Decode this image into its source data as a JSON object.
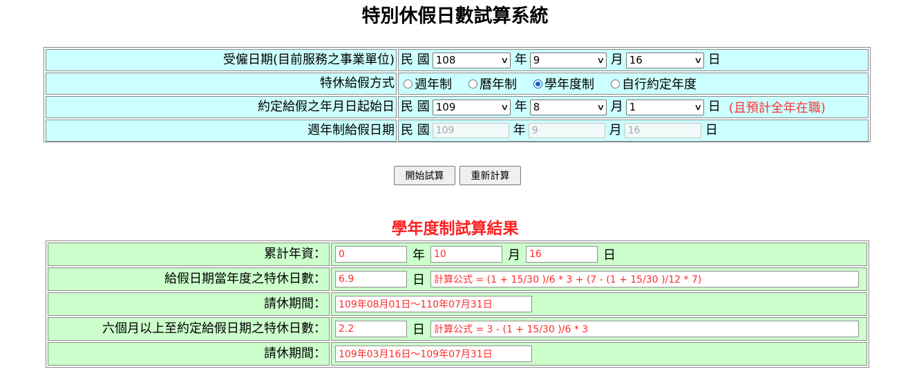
{
  "title": "特別休假日數試算系統",
  "form": {
    "hire_date": {
      "label": "受僱日期(目前服務之事業單位)",
      "prefix": "民 國",
      "year": "108",
      "year_unit": "年",
      "month": "9",
      "month_unit": "月",
      "day": "16",
      "day_unit": "日"
    },
    "leave_method": {
      "label": "特休給假方式",
      "options": [
        {
          "label": "週年制",
          "checked": false
        },
        {
          "label": "曆年制",
          "checked": false
        },
        {
          "label": "學年度制",
          "checked": true
        },
        {
          "label": "自行約定年度",
          "checked": false
        }
      ]
    },
    "agreed_start": {
      "label": "約定給假之年月日起始日",
      "prefix": "民 國",
      "year": "109",
      "year_unit": "年",
      "month": "8",
      "month_unit": "月",
      "day": "1",
      "day_unit": "日",
      "note": "(且預計全年在職)"
    },
    "anniversary_date": {
      "label": "週年制給假日期",
      "prefix": "民 國",
      "year": "109",
      "year_unit": "年",
      "month": "9",
      "month_unit": "月",
      "day": "16",
      "day_unit": "日"
    }
  },
  "buttons": {
    "calculate": "開始試算",
    "recalculate": "重新計算"
  },
  "result": {
    "title": "學年度制試算結果",
    "seniority": {
      "label": "累計年資：",
      "years": "0",
      "years_unit": "年",
      "months": "10",
      "months_unit": "月",
      "days": "16",
      "days_unit": "日"
    },
    "current_year_days": {
      "label": "給假日期當年度之特休日數：",
      "value": "6.9",
      "unit": "日",
      "formula": "計算公式 = (1 + 15/30 )/6 * 3 + (7 - (1 + 15/30 )/12 * 7)"
    },
    "current_period": {
      "label": "請休期間：",
      "value": "109年08月01日～110年07月31日"
    },
    "six_month_days": {
      "label": "六個月以上至約定給假日期之特休日數：",
      "value": "2.2",
      "unit": "日",
      "formula": "計算公式 = 3 - (1 + 15/30 )/6 * 3"
    },
    "six_month_period": {
      "label": "請休期間：",
      "value": "109年03月16日～109年07月31日"
    }
  }
}
